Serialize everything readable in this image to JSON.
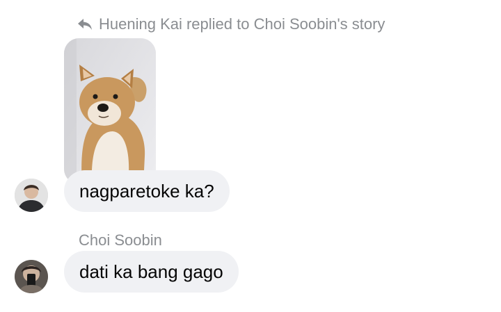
{
  "reply_header": {
    "icon": "reply-icon",
    "text": "Huening Kai replied to Choi Soobin's story"
  },
  "story": {
    "thumbnail": "shiba-inu-dog-photo"
  },
  "messages": [
    {
      "sender_avatar": "huening-kai-avatar",
      "text": "nagparetoke ka?"
    },
    {
      "sender_name": "Choi Soobin",
      "sender_avatar": "choi-soobin-avatar",
      "text": "dati ka bang gago"
    }
  ],
  "colors": {
    "bubble_bg": "#f0f1f4",
    "meta_text": "#8a8d91",
    "message_text": "#050505"
  }
}
